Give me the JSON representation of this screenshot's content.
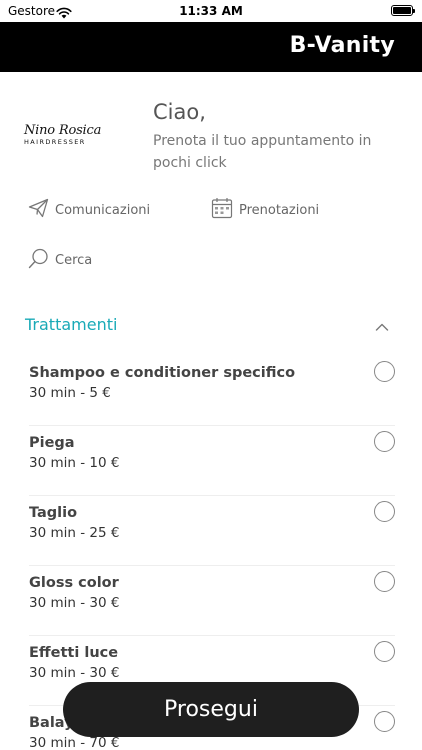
{
  "status": {
    "carrier": "Gestore",
    "time": "11:33 AM"
  },
  "header": {
    "title": "B-Vanity"
  },
  "brand": {
    "name": "Nino Rosica",
    "subtitle": "HAIRDRESSER"
  },
  "greeting": {
    "title": "Ciao,",
    "subtitle": "Prenota il tuo appuntamento in pochi click"
  },
  "quick_links": [
    {
      "label": "Comunicazioni",
      "icon": "paper-plane-icon"
    },
    {
      "label": "Prenotazioni",
      "icon": "calendar-icon"
    },
    {
      "label": "Cerca",
      "icon": "search-icon"
    }
  ],
  "section": {
    "title": "Trattamenti",
    "expanded": true
  },
  "services": [
    {
      "name": "Shampoo e conditioner specifico",
      "meta": "30 min - 5 €",
      "selected": false
    },
    {
      "name": "Piega",
      "meta": "30 min - 10 €",
      "selected": false
    },
    {
      "name": "Taglio",
      "meta": "30 min - 25 €",
      "selected": false
    },
    {
      "name": "Gloss color",
      "meta": "30 min - 30 €",
      "selected": false
    },
    {
      "name": "Effetti luce",
      "meta": "30 min - 30 €",
      "selected": false
    },
    {
      "name": "Balayage",
      "meta": "30 min - 70 €",
      "selected": false
    }
  ],
  "cta": {
    "label": "Prosegui"
  },
  "colors": {
    "accent": "#19aab7",
    "header_bg": "#000000",
    "cta_bg": "#1f1f1f"
  }
}
